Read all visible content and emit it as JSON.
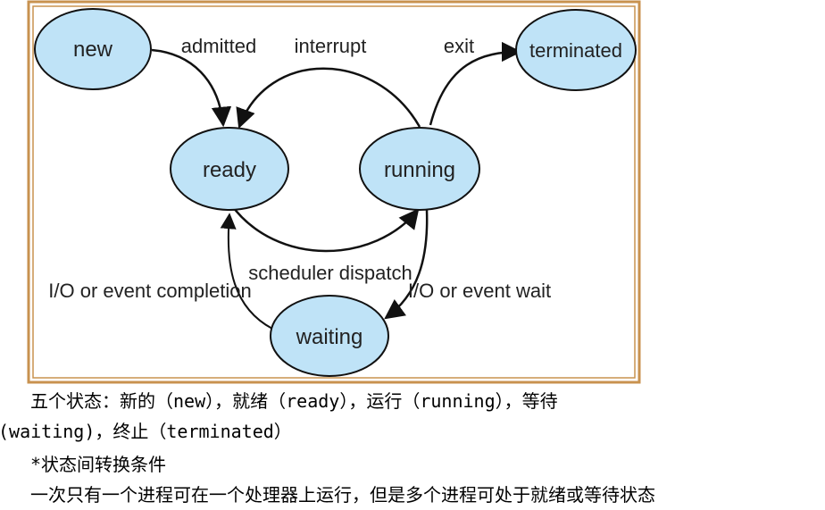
{
  "diagram": {
    "states": {
      "new": "new",
      "ready": "ready",
      "running": "running",
      "waiting": "waiting",
      "terminated": "terminated"
    },
    "edges": {
      "admitted": "admitted",
      "interrupt": "interrupt",
      "exit": "exit",
      "scheduler_dispatch": "scheduler dispatch",
      "io_event_wait": "I/O or event wait",
      "io_event_completion": "I/O or event completion"
    },
    "colors": {
      "frame": "#c8924f",
      "state_fill": "#bfe3f7",
      "state_stroke": "#111111"
    }
  },
  "text": {
    "line1": "五个状态：新的（new），就绪（ready），运行（running），等待",
    "line2": "(waiting)，终止（terminated）",
    "line3": "*状态间转换条件",
    "line4": "一次只有一个进程可在一个处理器上运行，但是多个进程可处于就绪或等待状态"
  }
}
